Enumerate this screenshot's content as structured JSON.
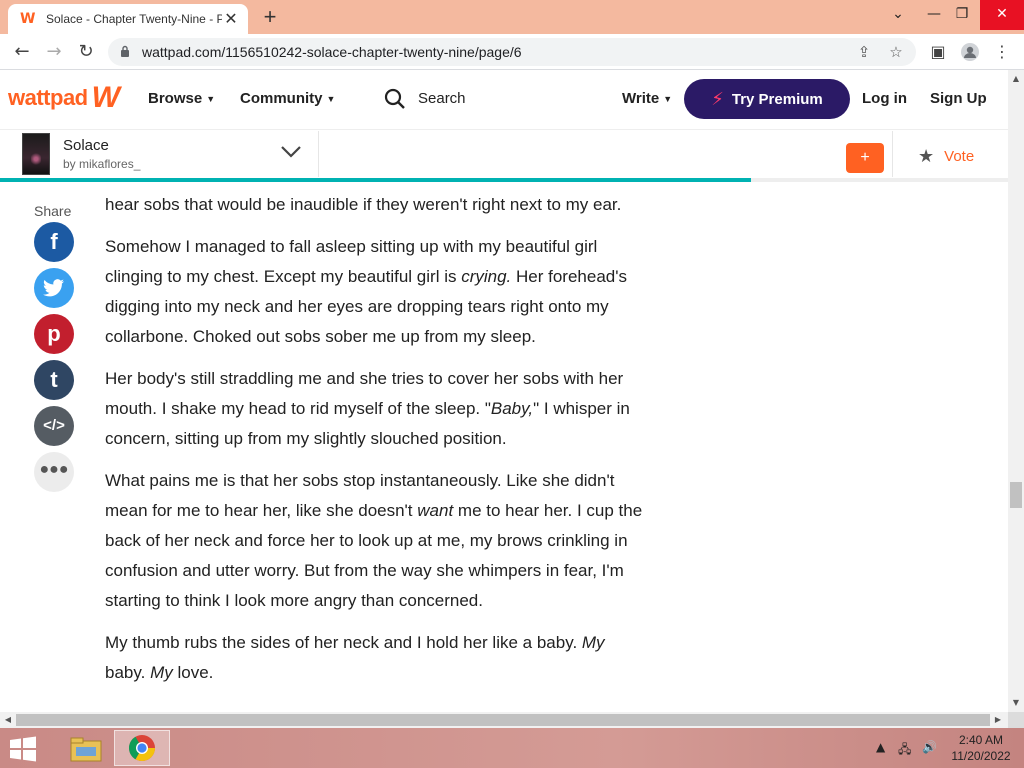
{
  "browser": {
    "tab_title": "Solace - Chapter Twenty-Nine - P",
    "url": "wattpad.com/1156510242-solace-chapter-twenty-nine/page/6"
  },
  "header": {
    "logo": "wattpad",
    "browse": "Browse",
    "community": "Community",
    "search": "Search",
    "write": "Write",
    "premium": "Try Premium",
    "login": "Log in",
    "signup": "Sign Up"
  },
  "story": {
    "title": "Solace",
    "author": "by mikaflores_",
    "add_label": "+",
    "vote_label": "Vote",
    "progress_fraction": 0.745
  },
  "share": {
    "label": "Share"
  },
  "content": {
    "p1": "hear sobs that would be inaudible if they weren't right next to my ear.",
    "p2_a": "Somehow I managed to fall asleep sitting up with my beautiful girl clinging to my chest. Except my beautiful girl is ",
    "p2_em": "crying.",
    "p2_b": " Her forehead's digging into my neck and her eyes are dropping tears right onto my collarbone. Choked out sobs sober me up from my sleep.",
    "p3_a": "Her body's still straddling me and she tries to cover her sobs with her mouth. I shake my head to rid myself of the sleep. \"",
    "p3_em": "Baby,",
    "p3_b": "\" I whisper in concern, sitting up from my slightly slouched position.",
    "p4_a": "What pains me is that her sobs stop instantaneously. Like she didn't mean for me to hear her, like she doesn't ",
    "p4_em": "want",
    "p4_b": " me to hear her. I cup the back of her neck and force her to look up at me, my brows crinkling in confusion and utter worry. But from the way she whimpers in fear, I'm starting to think I look more angry than concerned.",
    "p5_a": "My thumb rubs the sides of her neck and I hold her like a baby. ",
    "p5_em1": "My",
    "p5_b": " baby. ",
    "p5_em2": "My",
    "p5_c": " love."
  },
  "taskbar": {
    "time": "2:40 AM",
    "date": "11/20/2022"
  },
  "colors": {
    "brand": "#ff6122",
    "premium_bg": "#2b1a66",
    "progress": "#00b2b2",
    "facebook": "#1c5aa3",
    "twitter": "#3aa1f0",
    "pinterest": "#c21f2e",
    "tumblr": "#2f4663",
    "embed": "#555c63"
  }
}
